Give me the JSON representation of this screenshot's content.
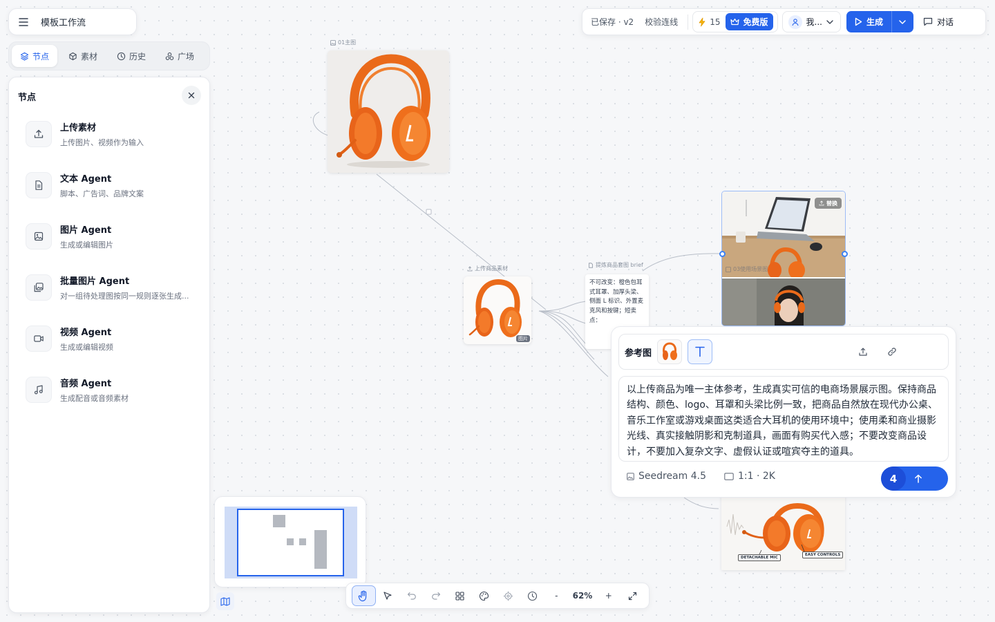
{
  "titlebar": {
    "title": "模板工作流",
    "menu_icon": "hamburger-menu-icon"
  },
  "left_tabs": [
    {
      "label": "节点",
      "icon": "layers-icon",
      "active": true
    },
    {
      "label": "素材",
      "icon": "cube-icon",
      "active": false
    },
    {
      "label": "历史",
      "icon": "clock-icon",
      "active": false
    },
    {
      "label": "广场",
      "icon": "plaza-icon",
      "active": false
    }
  ],
  "node_panel": {
    "title": "节点",
    "items": [
      {
        "title": "上传素材",
        "desc": "上传图片、视频作为输入",
        "icon": "upload-icon"
      },
      {
        "title": "文本 Agent",
        "desc": "脚本、广告词、品牌文案",
        "icon": "document-icon"
      },
      {
        "title": "图片 Agent",
        "desc": "生成或编辑图片",
        "icon": "image-icon"
      },
      {
        "title": "批量图片 Agent",
        "desc": "对一组待处理图按同一规则逐张生成...",
        "icon": "images-icon"
      },
      {
        "title": "视频 Agent",
        "desc": "生成或编辑视频",
        "icon": "video-icon"
      },
      {
        "title": "音频 Agent",
        "desc": "生成配音或音频素材",
        "icon": "music-icon"
      }
    ]
  },
  "top_toolbar": {
    "save_status": "已保存 · v2",
    "validate": "校验连线",
    "credits": "15",
    "plan": "免费版",
    "user": "我...",
    "generate": "生成",
    "chat": "对话",
    "accent": "#2563eb"
  },
  "canvas": {
    "main_image_label": "01主图",
    "upload_node_label": "上传商品素材",
    "upload_badge": "图片",
    "brief_label": "提炼商品套图 brief",
    "brief_text": "不可改变：橙色包耳式耳罩、加厚头梁、侧面 L 标识、外置麦克风和按键；短卖点：",
    "scene_label": "03使用场景图",
    "replace_button": "替换",
    "feature_tag_1": "DETACHABLE MIC",
    "feature_tag_2": "EASY CONTROLS"
  },
  "prompt_panel": {
    "ref_label": "参考图",
    "prompt": "以上传商品为唯一主体参考，生成真实可信的电商场景展示图。保持商品结构、颜色、logo、耳罩和头梁比例一致，把商品自然放在现代办公桌、音乐工作室或游戏桌面这类适合大耳机的使用环境中；使用柔和商业摄影光线、真实接触阴影和克制道具，画面有购买代入感；不要改变商品设计，不要加入复杂文字、虚假认证或喧宾夺主的道具。",
    "model": "Seedream 4.5",
    "ratio": "1:1 · 2K",
    "count": "4"
  },
  "bottom_toolbar": {
    "zoom": "62%",
    "minus": "-",
    "plus": "+"
  }
}
